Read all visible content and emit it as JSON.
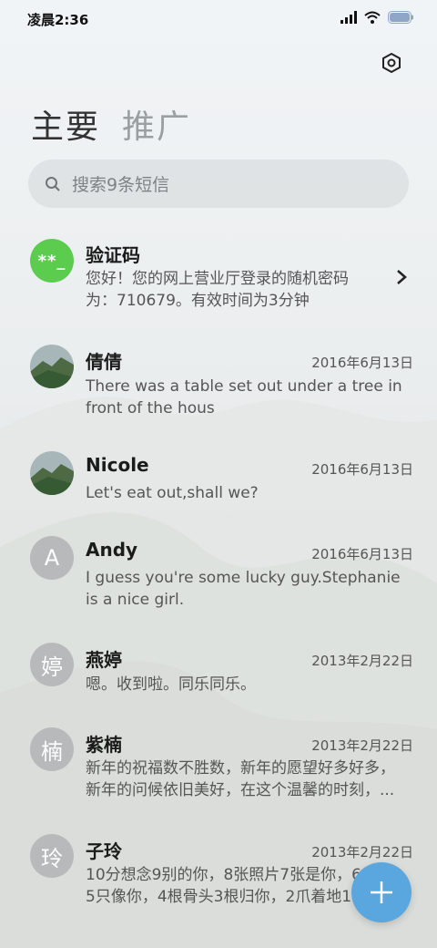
{
  "status": {
    "time": "凌晨2:36"
  },
  "header": {
    "tabs": [
      {
        "label": "主要"
      },
      {
        "label": "推广"
      }
    ]
  },
  "search": {
    "placeholder": "搜索9条短信"
  },
  "conversations": [
    {
      "name": "验证码",
      "avatar_text": "**_",
      "preview": "您好！您的网上营业厅登录的随机密码为：710679。有效时间为3分钟"
    },
    {
      "name": "倩倩",
      "date": "2016年6月13日",
      "preview": "There was a table set out under a tree in front of the hous"
    },
    {
      "name": "Nicole",
      "date": "2016年6月13日",
      "preview": "Let's eat out,shall we?"
    },
    {
      "name": "Andy",
      "date": "2016年6月13日",
      "avatar_text": "A",
      "preview": "I guess you're some lucky guy.Stephanie is a nice girl."
    },
    {
      "name": "燕婷",
      "date": "2013年2月22日",
      "avatar_text": "婷",
      "preview": "嗯。收到啦。同乐同乐。"
    },
    {
      "name": "紫楠",
      "date": "2013年2月22日",
      "avatar_text": "楠",
      "preview_line1": "新年的祝福数不胜数，新年的愿望好多好多，",
      "preview_line2": "新年的问候依旧美好，在这个温馨的时刻，..."
    },
    {
      "name": "子玲",
      "date": "2013年2月22日",
      "avatar_text": "玲",
      "preview_line1": "10分想念9别的你，8张照片7张是你，6",
      "preview_line2": "5只像你，4根骨头3根归你，2爪着地1"
    }
  ],
  "colors": {
    "verify_avatar": "#5ccc4f",
    "letter_avatar": "#b7b9ba",
    "fab": "#5aa7e0"
  }
}
